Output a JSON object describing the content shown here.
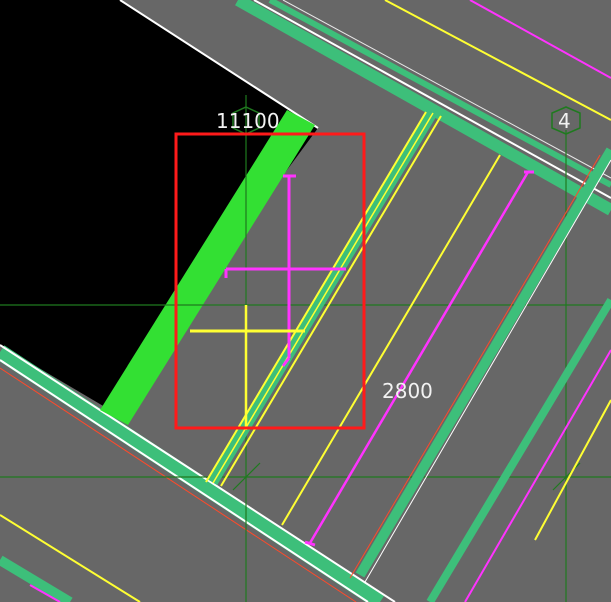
{
  "canvas": {
    "background_color": "#676767",
    "void_color": "#000000"
  },
  "dimensions": {
    "top_label": "11100",
    "right_label": "2800"
  },
  "grid_axes": {
    "axis_4_label": "4",
    "axis_color": "#1f7a1f"
  },
  "colors": {
    "wall_green": "#3dbf7a",
    "highlight_green": "#33e033",
    "yellow": "#ffff33",
    "magenta": "#ff33ff",
    "white": "#ffffff",
    "red_line": "#ff4a2a",
    "selection_red": "#ff1a1a"
  },
  "selection": {
    "visible": true
  }
}
